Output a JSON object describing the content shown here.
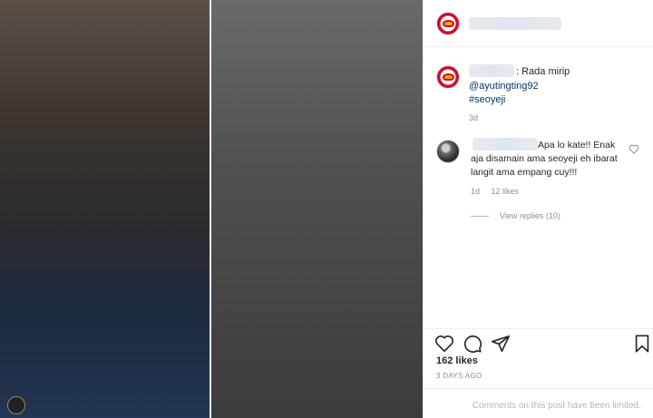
{
  "post": {
    "caption_text": ": Rada mirip",
    "mention": "@ayutingting92",
    "hashtag": "#seoyeji",
    "caption_time": "3d"
  },
  "comment": {
    "text": "Apa lo kate!! Enak aja disamain ama seoyeji eh ibarat langit ama empang cuy!!!",
    "time": "1d",
    "likes": "12 likes",
    "view_replies": "View replies (10)"
  },
  "footer": {
    "likes": "162 likes",
    "date": "3 DAYS AGO",
    "limited_notice": "Comments on this post have been limited."
  },
  "icons": {
    "like": "heart-icon",
    "comment": "comment-bubble-icon",
    "share": "paper-plane-icon",
    "save": "bookmark-icon",
    "comment_like": "heart-outline-small-icon"
  },
  "colors": {
    "link": "#00376b",
    "muted": "#8e8e8e",
    "brand_red": "#c8102e"
  }
}
